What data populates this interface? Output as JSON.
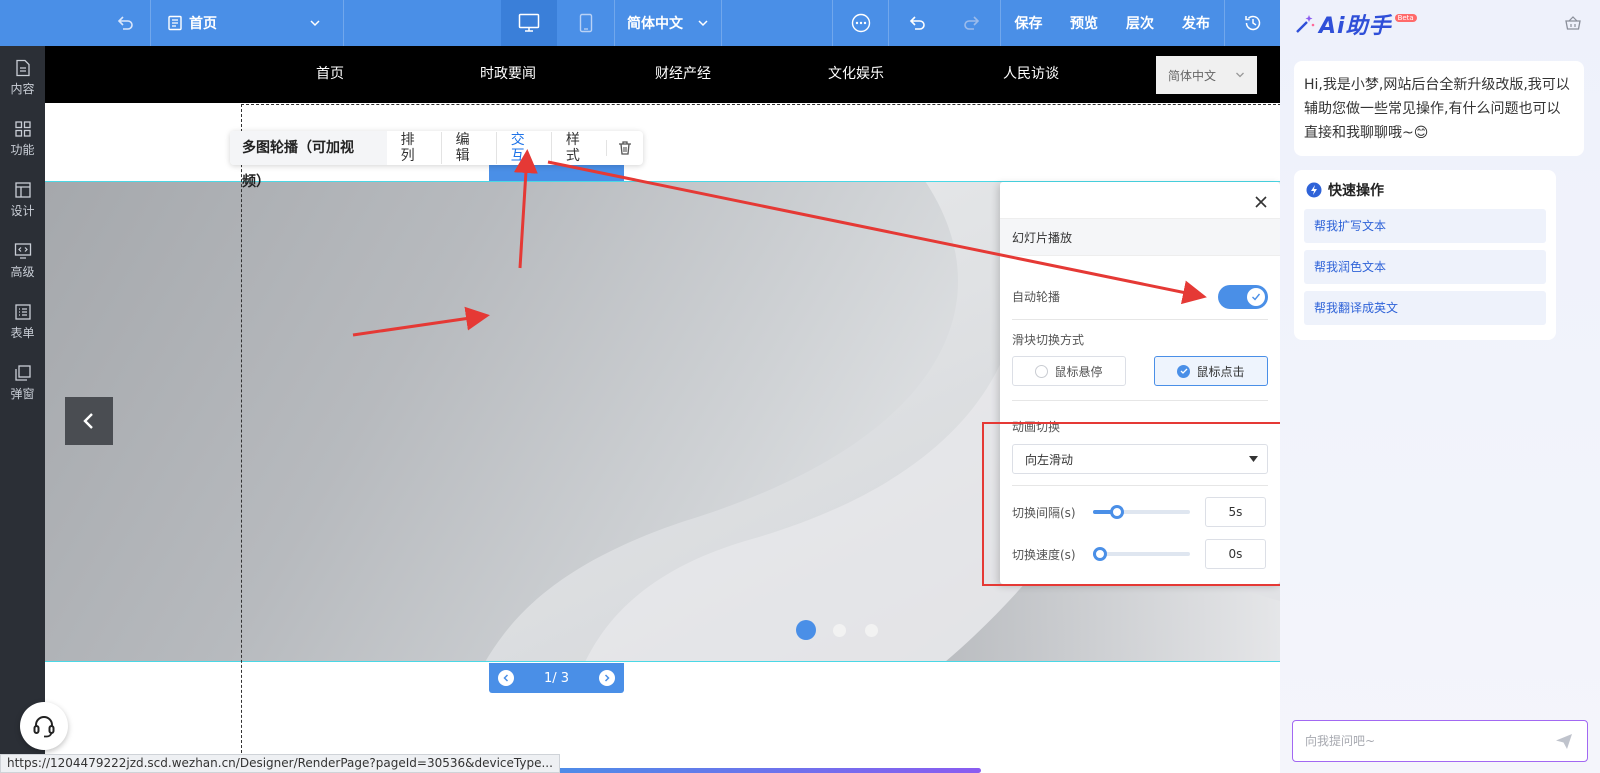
{
  "topbar": {
    "page_select": "首页",
    "language": "简体中文",
    "actions": [
      "保存",
      "预览",
      "层次",
      "发布"
    ]
  },
  "left_rail": {
    "items": [
      "内容",
      "功能",
      "设计",
      "高级",
      "表单",
      "弹窗"
    ]
  },
  "site_nav": {
    "items": [
      "首页",
      "时政要闻",
      "财经产经",
      "文化娱乐",
      "人民访谈"
    ],
    "language": "简体中文"
  },
  "context_toolbar": {
    "title": "多图轮播（可加视频）",
    "items": [
      "排列",
      "编辑",
      "交互",
      "样式"
    ],
    "active": "交互"
  },
  "slider": {
    "pager_text": "1/ 3",
    "current": 1,
    "total": 3
  },
  "panel": {
    "section_title": "幻灯片播放",
    "autoplay_label": "自动轮播",
    "autoplay_on": true,
    "switch_mode_label": "滑块切换方式",
    "switch_modes": [
      "鼠标悬停",
      "鼠标点击"
    ],
    "switch_mode_selected": "鼠标点击",
    "animation_label": "动画切换",
    "animation_value": "向左滑动",
    "interval_label": "切换间隔(s)",
    "interval_value": "5s",
    "interval_fraction": 0.2,
    "speed_label": "切换速度(s)",
    "speed_value": "0s",
    "speed_fraction": 0.0
  },
  "ai": {
    "title": "Ai助手",
    "badge": "Beta",
    "greeting": "Hi,我是小梦,网站后台全新升级改版,我可以辅助您做一些常见操作,有什么问题也可以直接和我聊聊哦~😊",
    "quick_title": "快速操作",
    "quick_items": [
      "帮我扩写文本",
      "帮我润色文本",
      "帮我翻译成英文"
    ],
    "input_placeholder": "向我提问吧~"
  },
  "status_url": "https://1204479222jzd.scd.wezhan.cn/Designer/RenderPage?pageId=30536&deviceType...",
  "colors": {
    "primary": "#4a8fe7",
    "rail": "#2b2f36",
    "annotation_red": "#e53935",
    "ai_brand": "#2f4fd8"
  }
}
